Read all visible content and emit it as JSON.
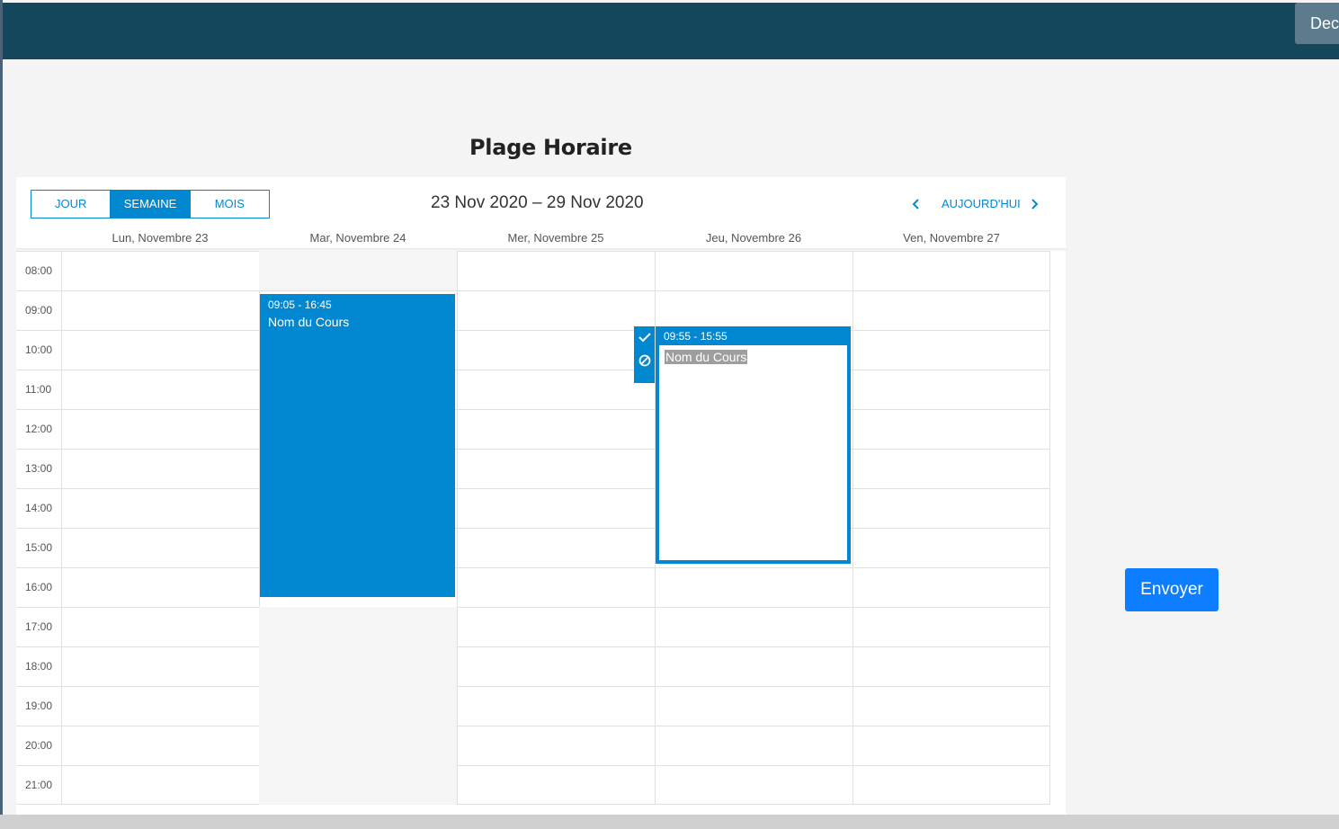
{
  "topbar": {
    "button_label": "Dec"
  },
  "page": {
    "title": "Plage Horaire"
  },
  "scheduler": {
    "views": [
      {
        "label": "JOUR",
        "active": false
      },
      {
        "label": "SEMAINE",
        "active": true
      },
      {
        "label": "MOIS",
        "active": false
      }
    ],
    "date_range": "23 Nov 2020 – 29 Nov 2020",
    "prev_icon": "chevron-left-icon",
    "next_icon": "chevron-right-icon",
    "today_label": "AUJOURD'HUI",
    "days": [
      "Lun, Novembre 23",
      "Mar, Novembre 24",
      "Mer, Novembre 25",
      "Jeu, Novembre 26",
      "Ven, Novembre 27"
    ],
    "hours": [
      "08:00",
      "09:00",
      "10:00",
      "11:00",
      "12:00",
      "13:00",
      "14:00",
      "15:00",
      "16:00",
      "17:00",
      "18:00",
      "19:00",
      "20:00",
      "21:00"
    ],
    "events": [
      {
        "time": "09:05 - 16:45",
        "name": "Nom du Cours",
        "day": "Mar, Novembre 24",
        "state": "saved"
      },
      {
        "time": "09:55 - 15:55",
        "name": "Nom du Cours",
        "day": "Jeu, Novembre 26",
        "state": "editing"
      }
    ],
    "event_actions": {
      "confirm_icon": "check-icon",
      "cancel_icon": "block-icon"
    },
    "accent_color": "#0288d1"
  },
  "submit_label": "Envoyer"
}
